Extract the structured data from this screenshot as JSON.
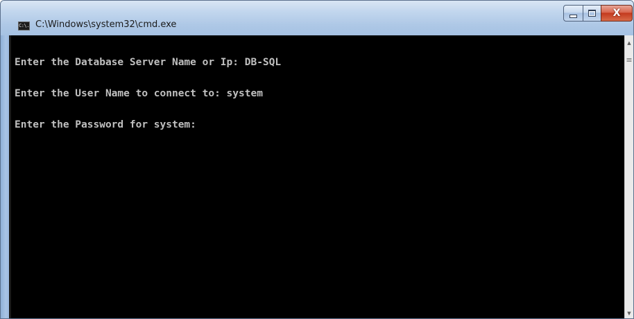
{
  "window": {
    "title": "C:\\Windows\\system32\\cmd.exe",
    "icon": "cmd-icon",
    "icon_text": "C:\\."
  },
  "controls": {
    "minimize_icon": "minimize-icon",
    "maximize_icon": "maximize-icon",
    "close_icon": "close-icon",
    "close_glyph": "X"
  },
  "console": {
    "background": "#000000",
    "foreground": "#c0c0c0",
    "lines": [
      "Enter the Database Server Name or Ip: DB-SQL",
      "Enter the User Name to connect to: system",
      "Enter the Password for system:"
    ]
  },
  "scrollbar": {
    "up_glyph": "▲",
    "down_glyph": "▼",
    "grip_glyph": "≡"
  }
}
